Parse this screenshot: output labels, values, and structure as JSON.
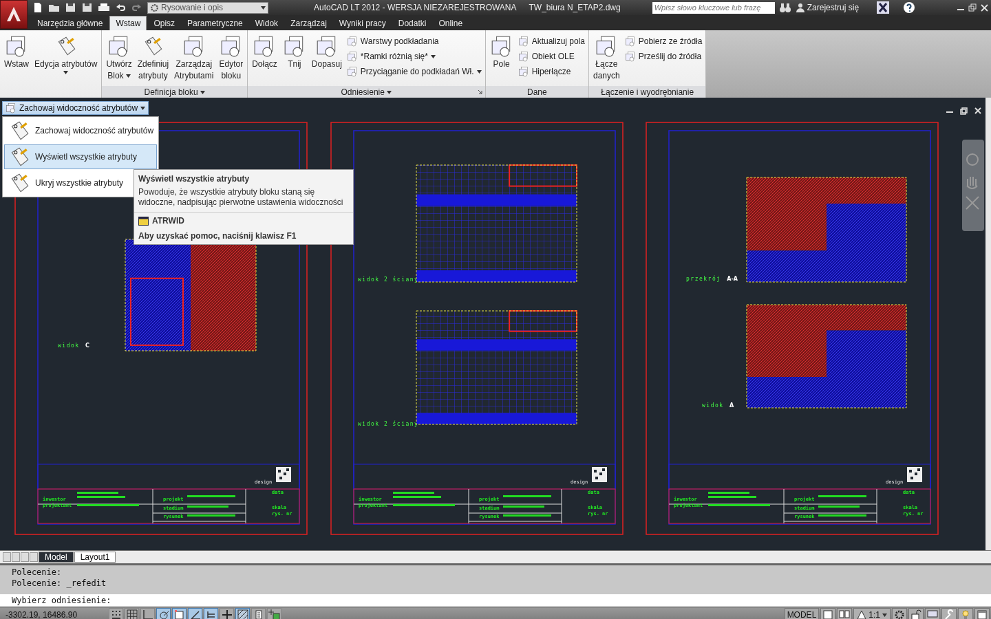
{
  "quick_access": {
    "workspace": "Rysowanie i opis"
  },
  "window": {
    "title": "AutoCAD LT 2012 - WERSJA NIEZAREJESTROWANA",
    "file": "TW_biura N_ETAP2.dwg"
  },
  "search": {
    "placeholder": "Wpisz słowo kluczowe lub frazę"
  },
  "sign_in": "Zarejestruj się",
  "ribbon_tabs": [
    {
      "label": "Narzędzia główne",
      "selected": false
    },
    {
      "label": "Wstaw",
      "selected": true
    },
    {
      "label": "Opisz",
      "selected": false
    },
    {
      "label": "Parametryczne",
      "selected": false
    },
    {
      "label": "Widok",
      "selected": false
    },
    {
      "label": "Zarządzaj",
      "selected": false
    },
    {
      "label": "Wyniki pracy",
      "selected": false
    },
    {
      "label": "Dodatki",
      "selected": false
    },
    {
      "label": "Online",
      "selected": false
    }
  ],
  "panels": [
    {
      "large": [
        {
          "lines": [
            "Wstaw"
          ],
          "dropdown": false
        },
        {
          "lines": [
            "Edycja atrybutów"
          ],
          "dropdown": true
        }
      ]
    },
    {
      "title": "Definicja bloku",
      "menu": true,
      "launcher": false,
      "large": [
        {
          "lines": [
            "Utwórz",
            "Blok"
          ],
          "dropdown": true
        },
        {
          "lines": [
            "Zdefiniuj",
            "atrybuty"
          ],
          "dropdown": false
        },
        {
          "lines": [
            "Zarządzaj",
            "Atrybutami"
          ],
          "dropdown": false
        },
        {
          "lines": [
            "Edytor",
            "bloku"
          ],
          "dropdown": false
        }
      ]
    },
    {
      "title": "Odniesienie",
      "menu": true,
      "launcher": true,
      "large": [
        {
          "lines": [
            "Dołącz"
          ],
          "dropdown": false
        },
        {
          "lines": [
            "Tnij"
          ],
          "dropdown": false
        },
        {
          "lines": [
            "Dopasuj"
          ],
          "dropdown": false
        }
      ],
      "small": [
        {
          "label": "Warstwy podkładania",
          "dropdown": false
        },
        {
          "label": "*Ramki różnią się*",
          "dropdown": true
        },
        {
          "label": "Przyciąganie do podkładań Wł.",
          "dropdown": true
        }
      ]
    },
    {
      "title": "Dane",
      "menu": false,
      "launcher": false,
      "large": [
        {
          "lines": [
            "Pole"
          ],
          "dropdown": false
        }
      ],
      "small": [
        {
          "label": "Aktualizuj  pola",
          "dropdown": false
        },
        {
          "label": "Obiekt OLE",
          "dropdown": false
        },
        {
          "label": "Hiperłącze",
          "dropdown": false
        }
      ]
    },
    {
      "title": "Łączenie i wyodrębnianie",
      "menu": false,
      "launcher": false,
      "large": [
        {
          "lines": [
            "Łącze",
            "danych"
          ],
          "dropdown": false
        }
      ],
      "small": [
        {
          "label": "Pobierz ze źródła",
          "dropdown": false
        },
        {
          "label": "Prześlij do źródła",
          "dropdown": false
        }
      ]
    }
  ],
  "attribute_visibility": {
    "button": "Zachowaj widoczność atrybutów",
    "items": [
      {
        "label": "Zachowaj widoczność atrybutów",
        "selected": false
      },
      {
        "label": "Wyświetl wszystkie atrybuty",
        "selected": true
      },
      {
        "label": "Ukryj wszystkie atrybuty",
        "selected": false
      }
    ]
  },
  "tooltip": {
    "title": "Wyświetl wszystkie atrybuty",
    "description": "Powoduje, że wszystkie atrybuty bloku staną się widoczne, nadpisując pierwotne ustawienia widoczności",
    "command": "ATRWID",
    "help": "Aby uzyskać pomoc, naciśnij klawisz F1"
  },
  "sheets": [
    {
      "views": [
        {
          "label": "widok",
          "tag": "C"
        }
      ],
      "title_block": [
        "inwestor",
        "projektant",
        "projekt",
        "stadium",
        "rysunek",
        "data",
        "skala",
        "rys. nr"
      ],
      "logo": "design"
    },
    {
      "views": [
        {
          "label": "widok 2 ściany"
        },
        {
          "label": "widok 2 ściany"
        }
      ],
      "title_block": [
        "inwestor",
        "projektant",
        "projekt",
        "stadium",
        "rysunek",
        "data",
        "skala",
        "rys. nr"
      ],
      "logo": "design"
    },
    {
      "views": [
        {
          "label": "przekrój",
          "tag": "A-A"
        },
        {
          "label": "widok",
          "tag": "A"
        }
      ],
      "title_block": [
        "inwestor",
        "projektant",
        "projekt",
        "stadium",
        "rysunek",
        "data",
        "skala",
        "rys. nr"
      ],
      "logo": "design"
    }
  ],
  "layout_tabs": [
    {
      "label": "Model",
      "selected": true
    },
    {
      "label": "Layout1",
      "selected": false
    }
  ],
  "command_line": {
    "history": [
      "Polecenie:",
      "Polecenie: _refedit"
    ],
    "prompt": "Wybierz odniesienie:"
  },
  "status_bar": {
    "coordinates": "-3302.19, 16486.90",
    "toggles": [
      {
        "on": false
      },
      {
        "on": false
      },
      {
        "on": false
      },
      {
        "on": true
      },
      {
        "on": true
      },
      {
        "on": true
      },
      {
        "on": true
      },
      {
        "on": false
      },
      {
        "on": true
      },
      {
        "on": false
      },
      {
        "on": false
      }
    ],
    "space": "MODEL",
    "scale": "1:1"
  }
}
